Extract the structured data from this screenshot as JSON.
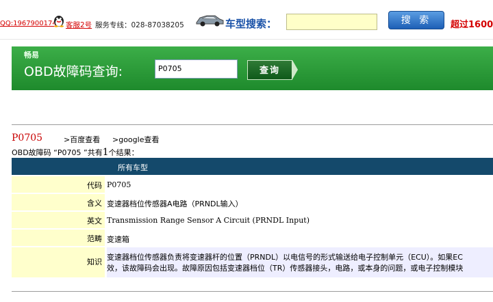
{
  "header": {
    "qq_link": "QQ:1967900174",
    "kefu_link": "客服2号",
    "hotline": "服务专线：028-87038205",
    "cartype_label": "车型搜索：",
    "search_button": "搜 索",
    "over_text": "超过1600"
  },
  "banner": {
    "subtitle": "畅易",
    "title": "OBD故障码查询:",
    "input_value": "P0705",
    "query_button": "查询"
  },
  "result": {
    "code": "P0705",
    "baidu_link": ">百度查看",
    "google_link": ">google查看",
    "summary_prefix": "OBD故障码  “P0705 ”共有",
    "summary_count": "1",
    "summary_suffix": "个结果：",
    "table_header": "所有车型",
    "rows": [
      {
        "label": "代码",
        "value": "P0705"
      },
      {
        "label": "含义",
        "value": "变速器档位传感器A电路（PRNDL输入）"
      },
      {
        "label": "英文",
        "value": "Transmission Range Sensor A Circuit (PRNDL Input)"
      },
      {
        "label": "范畴",
        "value": "变速箱"
      },
      {
        "label": "知识",
        "line1": "变速器档位传感器负责将变速器杆的位置（PRNDL）以电信号的形式输送给电子控制单元（ECU）。如果EC",
        "line2": "效，该故障码会出现。故障原因包括变速器档位（TR）传感器接头，电路，或本身的问题，或电子控制模块"
      }
    ]
  }
}
